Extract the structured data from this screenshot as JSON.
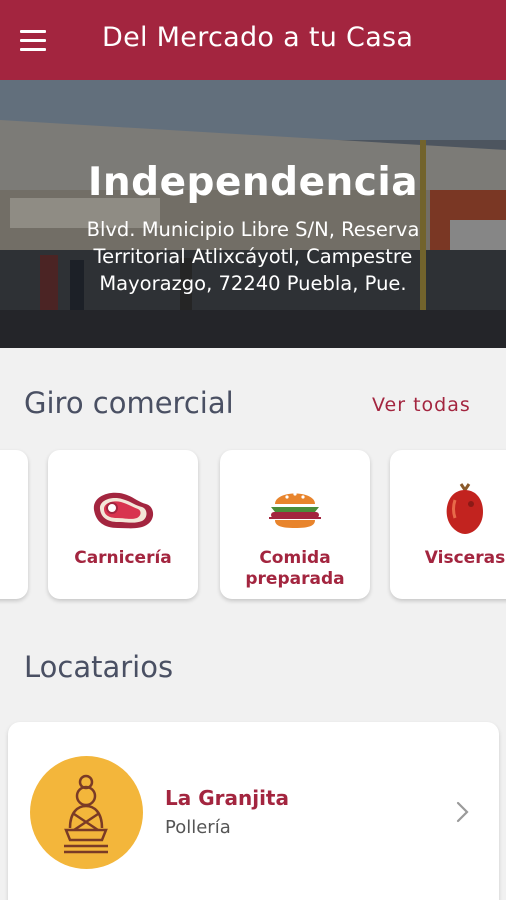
{
  "appbar": {
    "title": "Del Mercado a tu Casa",
    "menu_icon": "hamburger-menu-icon",
    "color": "#a3253f"
  },
  "market": {
    "name": "Independencia",
    "address": "Blvd. Municipio Libre S/N, Reserva Territorial Atlixcáyotl, Campestre Mayorazgo, 72240 Puebla, Pue."
  },
  "categories_section": {
    "title": "Giro comercial",
    "see_all": "Ver todas",
    "items": [
      {
        "label": "",
        "icon": "partial-card"
      },
      {
        "label": "Carnicería",
        "icon": "steak-icon"
      },
      {
        "label": "Comida preparada",
        "icon": "burger-icon"
      },
      {
        "label": "Visceras",
        "icon": "organ-icon"
      }
    ]
  },
  "tenants_section": {
    "title": "Locatarios",
    "items": [
      {
        "name": "La Granjita",
        "category": "Pollería",
        "avatar_color": "#f3b63b"
      }
    ]
  }
}
